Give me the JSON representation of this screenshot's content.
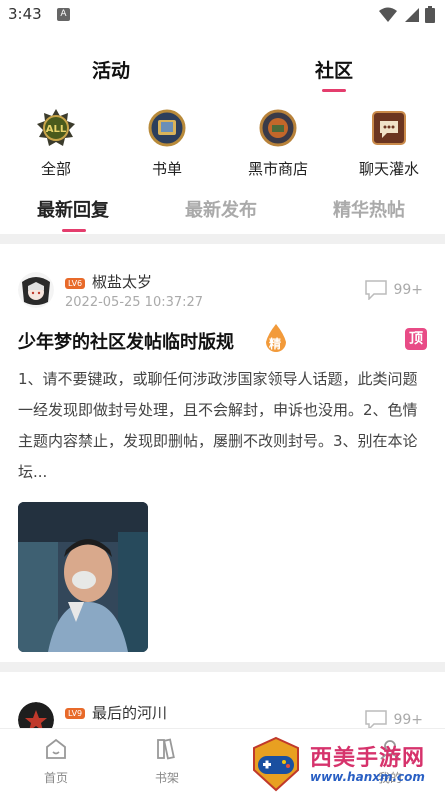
{
  "status_bar": {
    "time": "3:43",
    "notif_glyph": "A"
  },
  "top_tabs": {
    "activity": "活动",
    "community": "社区"
  },
  "categories": [
    {
      "label": "全部",
      "icon": "all-badge-icon"
    },
    {
      "label": "书单",
      "icon": "book-list-icon"
    },
    {
      "label": "黑市商店",
      "icon": "black-market-icon"
    },
    {
      "label": "聊天灌水",
      "icon": "chat-icon"
    }
  ],
  "sub_tabs": {
    "latest_reply": "最新回复",
    "latest_post": "最新发布",
    "featured": "精华热帖"
  },
  "posts": [
    {
      "level": "LV6",
      "author": "椒盐太岁",
      "time": "2022-05-25 10:37:27",
      "comments": "99+",
      "title": "少年梦的社区发帖临时版规",
      "jing_label": "精",
      "ding_label": "顶",
      "body": "1、请不要键政，或聊任何涉政涉国家领导人话题，此类问题一经发现即做封号处理，且不会解封，申诉也没用。2、色情主题内容禁止，发现即删帖，屡删不改则封号。3、别在本论坛..."
    },
    {
      "level": "LV9",
      "author": "最后的河川",
      "comments": "99+"
    }
  ],
  "bottom_nav": {
    "home": "首页",
    "bookshelf": "书架",
    "mine": "我的"
  },
  "watermark": {
    "text": "西美手游网",
    "url": "www.hanxm.com"
  },
  "colors": {
    "accent": "#e43d6d",
    "ding": "#e84b86",
    "level_badge": "#e86a2a"
  }
}
